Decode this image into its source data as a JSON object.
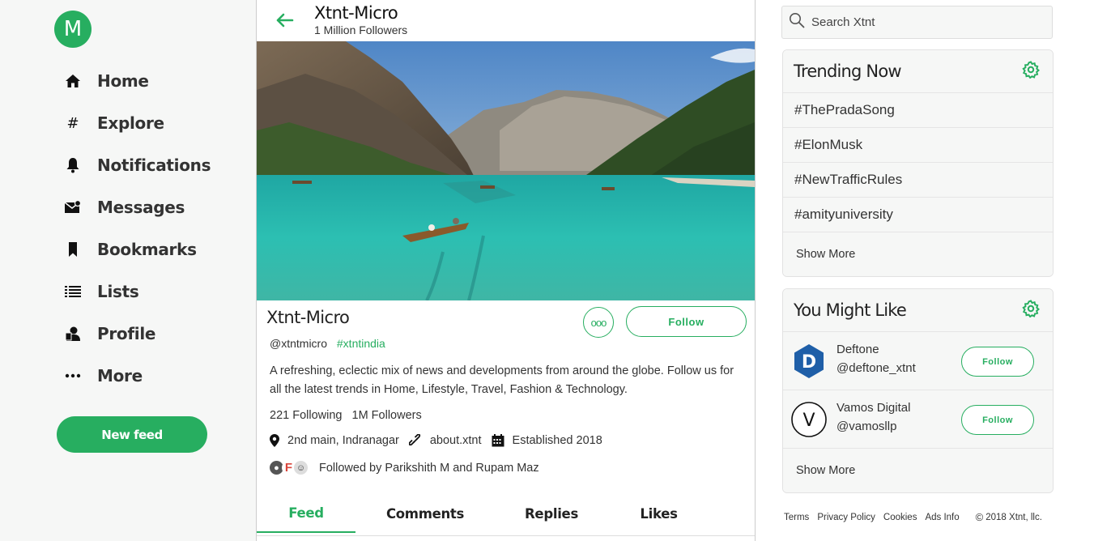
{
  "sidebar": {
    "avatar_letter": "M",
    "items": [
      {
        "label": "Home",
        "icon": "home-icon"
      },
      {
        "label": "Explore",
        "icon": "hash-icon"
      },
      {
        "label": "Notifications",
        "icon": "bell-icon"
      },
      {
        "label": "Messages",
        "icon": "envelope-icon"
      },
      {
        "label": "Bookmarks",
        "icon": "bookmark-icon"
      },
      {
        "label": "Lists",
        "icon": "list-icon"
      },
      {
        "label": "Profile",
        "icon": "profile-icon"
      },
      {
        "label": "More",
        "icon": "dots-icon"
      }
    ],
    "new_feed_label": "New feed"
  },
  "header": {
    "title": "Xtnt-Micro",
    "subtitle": "1 Million Followers"
  },
  "profile": {
    "name": "Xtnt-Micro",
    "more_label": "ooo",
    "follow_label": "Follow",
    "handle": "@xtntmicro",
    "hashtag": "#xtntindia",
    "bio": "A refreshing, eclectic mix of news and developments from around the globe. Follow us for all the latest trends in Home, Lifestyle, Travel, Fashion & Technology.",
    "following": "221 Following",
    "followers": "1M Followers",
    "location": "2nd main, Indranagar",
    "website": "about.xtnt",
    "established": "Established 2018",
    "followed_by": "Followed by Parikshith M and Rupam Maz",
    "follower_initial": "F"
  },
  "tabs": [
    {
      "label": "Feed"
    },
    {
      "label": "Comments"
    },
    {
      "label": "Replies"
    },
    {
      "label": "Likes"
    }
  ],
  "search": {
    "placeholder": "Search Xtnt"
  },
  "trending": {
    "title": "Trending Now",
    "items": [
      "#ThePradaSong",
      "#ElonMusk",
      "#NewTrafficRules",
      "#amityuniversity"
    ],
    "show_more": "Show More"
  },
  "suggestions": {
    "title": "You Might Like",
    "items": [
      {
        "name": "Deftone",
        "handle": "@deftone_xtnt",
        "avatar": "D",
        "follow_label": "Follow"
      },
      {
        "name": "Vamos Digital",
        "handle": "@vamosllp",
        "avatar": "V",
        "follow_label": "Follow"
      }
    ],
    "show_more": "Show More"
  },
  "footer": {
    "links": [
      "Terms",
      "Privacy Policy",
      "Cookies",
      "Ads Info"
    ],
    "copyright": "2018 Xtnt, llc."
  },
  "colors": {
    "accent": "#27ae60",
    "deftone": "#1f5fa8"
  }
}
